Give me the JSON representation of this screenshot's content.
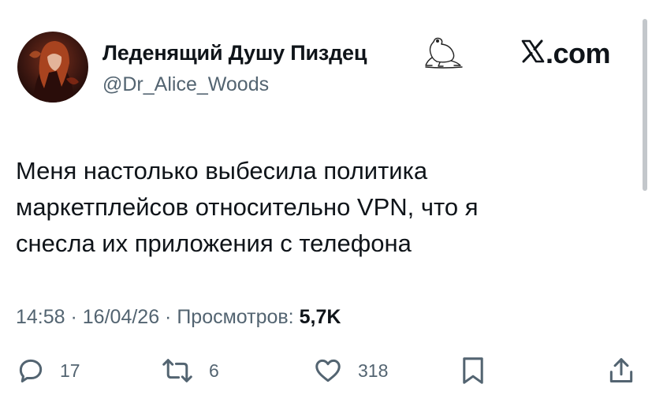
{
  "author": {
    "display_name": "Леденящий Душу Пиздец",
    "handle": "@Dr_Alice_Woods",
    "avatar_icon": "portrait-avatar",
    "badge_icon": "frog-icon"
  },
  "brand": {
    "text": ".com",
    "icon": "x-logo-icon"
  },
  "tweet": {
    "text": "Меня настолько выбесила политика\nмаркетплейсов относительно VPN, что я\nснесла их приложения с телефона"
  },
  "meta": {
    "time": "14:58",
    "separator": " · ",
    "date": "16/04/26",
    "views_label": "Просмотров:",
    "views_count": "5,7K"
  },
  "actions": {
    "replies": "17",
    "reposts": "6",
    "likes": "318"
  },
  "colors": {
    "text": "#0f1419",
    "secondary": "#536471",
    "background": "#ffffff"
  }
}
